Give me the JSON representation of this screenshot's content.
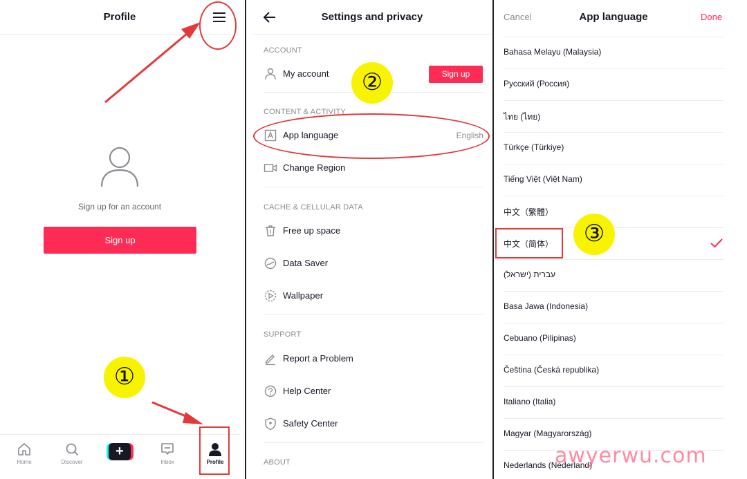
{
  "profile": {
    "title": "Profile",
    "signup_prompt": "Sign up for an account",
    "signup_button": "Sign up",
    "tabs": [
      {
        "label": "Home",
        "icon": "home-icon"
      },
      {
        "label": "Discover",
        "icon": "search-icon"
      },
      {
        "label": "",
        "icon": "plus-icon"
      },
      {
        "label": "Inbox",
        "icon": "inbox-icon"
      },
      {
        "label": "Profile",
        "icon": "person-icon"
      }
    ]
  },
  "settings": {
    "title": "Settings and privacy",
    "sections": {
      "account": "ACCOUNT",
      "content": "CONTENT & ACTIVITY",
      "cache": "CACHE & CELLULAR DATA",
      "support": "SUPPORT",
      "about": "ABOUT"
    },
    "my_account": "My account",
    "signup_button": "Sign up",
    "app_language": "App language",
    "app_language_value": "English",
    "change_region": "Change Region",
    "free_up_space": "Free up space",
    "data_saver": "Data Saver",
    "wallpaper": "Wallpaper",
    "report_problem": "Report a Problem",
    "help_center": "Help Center",
    "safety_center": "Safety Center"
  },
  "language": {
    "cancel": "Cancel",
    "title": "App language",
    "done": "Done",
    "items": [
      "Bahasa Melayu (Malaysia)",
      "Русский (Россия)",
      "ไทย (ไทย)",
      "Türkçe (Türkiye)",
      "Tiếng Việt (Việt Nam)",
      "中文（繁體）",
      "中文（简体）",
      "עברית (ישראל)",
      "Basa Jawa (Indonesia)",
      "Cebuano (Pilipinas)",
      "Čeština (Česká republika)",
      "Italiano (Italia)",
      "Magyar (Magyarország)",
      "Nederlands (Nederland)"
    ],
    "selected": "中文（简体）"
  },
  "annotations": {
    "step1": "①",
    "step2": "②",
    "step3": "③",
    "highlight_color": "#e23a3a",
    "badge_color": "#f8f400"
  },
  "colors": {
    "brand": "#fe2c55",
    "secondary_text": "#8a8b91"
  },
  "watermark": "awyerwu.com"
}
